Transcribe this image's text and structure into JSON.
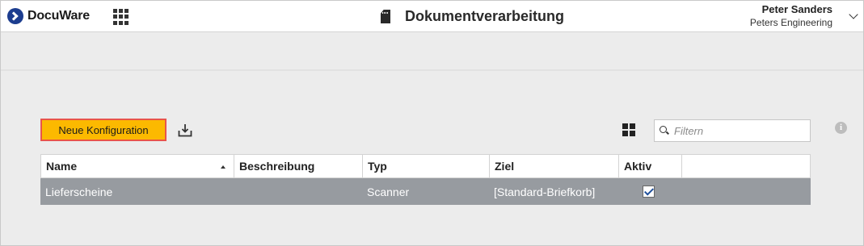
{
  "app": {
    "brand": "DocuWare",
    "page_title": "Dokumentverarbeitung"
  },
  "user": {
    "name": "Peter Sanders",
    "organization": "Peters Engineering"
  },
  "toolbar": {
    "new_config_label": "Neue Konfiguration",
    "filter_placeholder": "Filtern",
    "info_label": "i"
  },
  "colors": {
    "accent": "#fcb900",
    "accent_border": "#e8544b",
    "row_selected": "#979ba0",
    "brand_blue": "#1c3d8f"
  },
  "table": {
    "columns": [
      "Name",
      "Beschreibung",
      "Typ",
      "Ziel",
      "Aktiv",
      ""
    ],
    "sort": {
      "column": "Name",
      "direction": "ascending"
    },
    "rows": [
      {
        "name": "Lieferscheine",
        "description": "",
        "type": "Scanner",
        "target": "[Standard-Briefkorb]",
        "active": true
      }
    ]
  }
}
